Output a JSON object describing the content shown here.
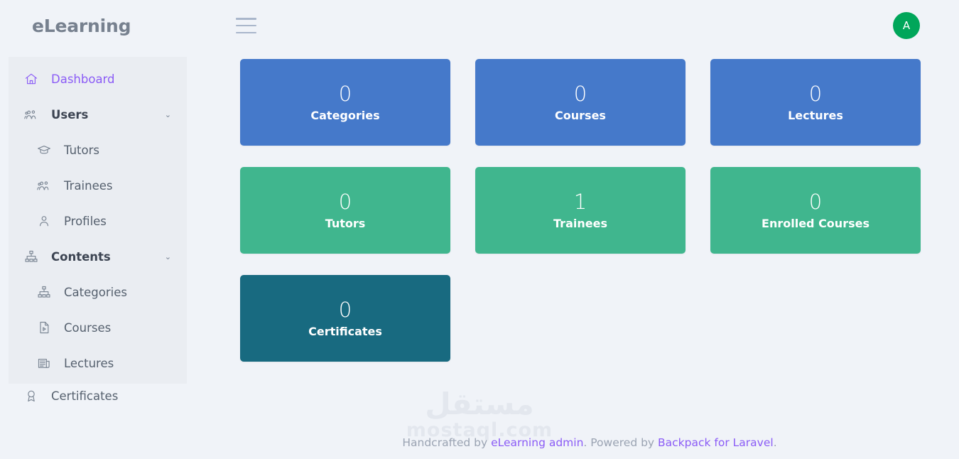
{
  "brand": {
    "title": "eLearning"
  },
  "header": {
    "menu_toggle_label": "Toggle navigation",
    "avatar_initial": "A"
  },
  "sidebar": {
    "items": [
      {
        "label": "Dashboard",
        "icon": "home-icon",
        "level": "top",
        "active": true,
        "expandable": false
      },
      {
        "label": "Users",
        "icon": "users-group-icon",
        "level": "top",
        "active": false,
        "expandable": true
      },
      {
        "label": "Tutors",
        "icon": "graduation-cap-icon",
        "level": "sub",
        "active": false,
        "expandable": false
      },
      {
        "label": "Trainees",
        "icon": "users-group-icon",
        "level": "sub",
        "active": false,
        "expandable": false
      },
      {
        "label": "Profiles",
        "icon": "person-icon",
        "level": "sub",
        "active": false,
        "expandable": false
      },
      {
        "label": "Contents",
        "icon": "sitemap-icon",
        "level": "top",
        "active": false,
        "expandable": true
      },
      {
        "label": "Categories",
        "icon": "sitemap-icon",
        "level": "sub",
        "active": false,
        "expandable": false
      },
      {
        "label": "Courses",
        "icon": "file-video-icon",
        "level": "sub",
        "active": false,
        "expandable": false
      },
      {
        "label": "Lectures",
        "icon": "news-icon",
        "level": "sub",
        "active": false,
        "expandable": false
      }
    ],
    "outside_items": [
      {
        "label": "Certificates",
        "icon": "award-ribbon-icon",
        "level": "top",
        "active": false,
        "expandable": false
      }
    ],
    "chevron_glyph": "⌄"
  },
  "cards": [
    {
      "value": "0",
      "label": "Categories",
      "color": "#4579ca"
    },
    {
      "value": "0",
      "label": "Courses",
      "color": "#4579ca"
    },
    {
      "value": "0",
      "label": "Lectures",
      "color": "#4579ca"
    },
    {
      "value": "0",
      "label": "Tutors",
      "color": "#40b68e"
    },
    {
      "value": "1",
      "label": "Trainees",
      "color": "#40b68e"
    },
    {
      "value": "0",
      "label": "Enrolled Courses",
      "color": "#40b68e"
    },
    {
      "value": "0",
      "label": "Certificates",
      "color": "#186a80"
    }
  ],
  "watermark": {
    "arabic": "مستقل",
    "latin": "mostaql.com"
  },
  "footer": {
    "prefix": "Handcrafted by ",
    "link1": "eLearning admin",
    "middle": ". Powered by ",
    "link2": "Backpack for Laravel",
    "suffix": "."
  },
  "theme": {
    "page_bg": "#f0f3f8",
    "nav_panel_bg": "#eaedf2",
    "accent_purple": "#8b5cf6",
    "avatar_green": "#00a65a",
    "blue": "#4579ca",
    "green": "#40b68e",
    "teal": "#186a80"
  }
}
